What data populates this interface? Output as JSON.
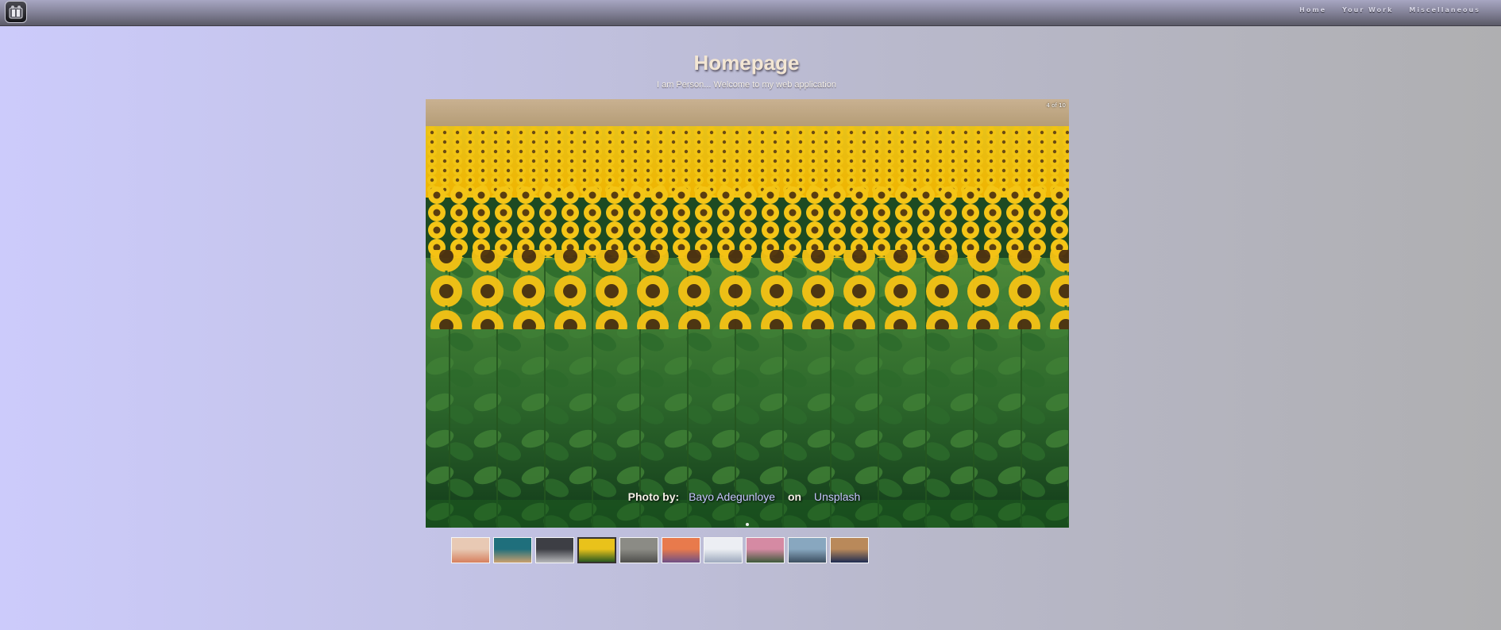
{
  "nav": {
    "items": [
      {
        "label": "Home"
      },
      {
        "label": "Your Work"
      },
      {
        "label": "Miscellaneous"
      }
    ]
  },
  "header": {
    "title": "Homepage",
    "subtitle": "I am Person... Welcome to my web application"
  },
  "slideshow": {
    "counter": "4 of 10",
    "current_index": 4,
    "total": 10,
    "credit_prefix": "Photo by",
    "photographer": "Bayo Adegunloye",
    "credit_joiner": "on",
    "source": "Unsplash"
  },
  "thumbnails": [
    {
      "name": "thumb-desert",
      "colors": [
        "#e8c9b4",
        "#d7805f"
      ]
    },
    {
      "name": "thumb-coast",
      "colors": [
        "#1f6f7c",
        "#c9a06f"
      ]
    },
    {
      "name": "thumb-storm-sea",
      "colors": [
        "#3d3e44",
        "#b7b8bb"
      ]
    },
    {
      "name": "thumb-sunflowers",
      "colors": [
        "#e9c21b",
        "#2b5a1f"
      ]
    },
    {
      "name": "thumb-crowd",
      "colors": [
        "#8b8b85",
        "#4f4f4c"
      ]
    },
    {
      "name": "thumb-sunset",
      "colors": [
        "#e87a4c",
        "#6e4f86"
      ]
    },
    {
      "name": "thumb-mountain-mist",
      "colors": [
        "#eceef3",
        "#9da9bd"
      ]
    },
    {
      "name": "thumb-flowers",
      "colors": [
        "#d58aa3",
        "#3e5a3b"
      ]
    },
    {
      "name": "thumb-lake",
      "colors": [
        "#88a7bf",
        "#3c4e60"
      ]
    },
    {
      "name": "thumb-portrait",
      "colors": [
        "#b9895a",
        "#1e2c52"
      ]
    }
  ]
}
